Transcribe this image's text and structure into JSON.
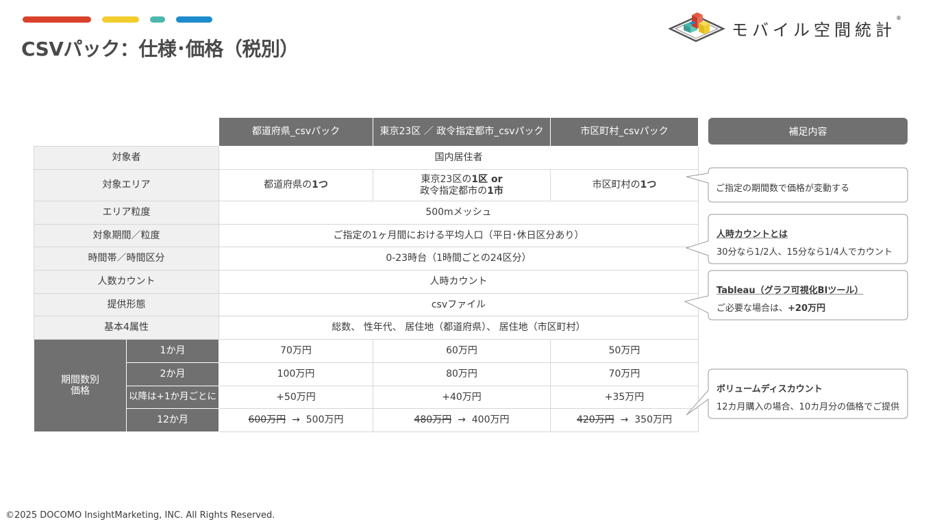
{
  "colors": {
    "bar_red": "#d9412b",
    "bar_yellow": "#f2cd2e",
    "bar_teal": "#4db7ad",
    "bar_blue": "#1d8ccc",
    "header_gray": "#707070",
    "rowhead_bg": "#f0f0f0"
  },
  "title": "CSVパック：仕様･価格（税別）",
  "logo": {
    "text": "モバイル空間統計",
    "mark": "®",
    "icon": "isometric-blocks-icon"
  },
  "table": {
    "columns": [
      "都道府県_csvパック",
      "東京23区 ／ 政令指定都市_csvパック",
      "市区町村_csvパック"
    ],
    "target_user": {
      "label": "対象者",
      "value": "国内居住者"
    },
    "area": {
      "label": "対象エリア",
      "pref": {
        "pre": "都道府県の",
        "bold": "1つ"
      },
      "tokyo": {
        "line1_pre": "東京23区の",
        "line1_bold": "1区 or",
        "line2_pre": "政令指定都市の",
        "line2_bold": "1市"
      },
      "city": {
        "pre": "市区町村の",
        "bold": "1つ"
      }
    },
    "granularity": {
      "label": "エリア粒度",
      "value": "500mメッシュ"
    },
    "period": {
      "label": "対象期間／粒度",
      "value": "ご指定の1ヶ月間における平均人口（平日･休日区分あり）"
    },
    "timeband": {
      "label": "時間帯／時間区分",
      "value": "0-23時台（1時間ごとの24区分）"
    },
    "count": {
      "label": "人数カウント",
      "value": "人時カウント"
    },
    "format": {
      "label": "提供形態",
      "value": "csvファイル"
    },
    "attrs": {
      "label": "基本4属性",
      "value": "総数、 性年代、 居住地（都道府県）、 居住地（市区町村）"
    },
    "price": {
      "group_line1": "期間数別",
      "group_line2": "価格",
      "rows": [
        {
          "label": "1か月",
          "pref": "70万円",
          "tokyo": "60万円",
          "city": "50万円"
        },
        {
          "label": "2か月",
          "pref": "100万円",
          "tokyo": "80万円",
          "city": "70万円"
        },
        {
          "label": "以降は+1か月ごとに",
          "pref": "+50万円",
          "tokyo": "+40万円",
          "city": "+35万円"
        }
      ],
      "twelve": {
        "label": "12か月",
        "arrow": "→",
        "pref_old": "600万円",
        "pref_new": "500万円",
        "tokyo_old": "480万円",
        "tokyo_new": "400万円",
        "city_old": "420万円",
        "city_new": "350万円"
      }
    }
  },
  "notes": {
    "header": "補足内容",
    "area_note": "ご指定の期間数で価格が変動する",
    "count_title": "人時カウントとは",
    "count_body": "30分なら1/2人、15分なら1/4人でカウント",
    "tableau_title": "Tableau（グラフ可視化BIツール）",
    "tableau_body_pre": "ご必要な場合は、",
    "tableau_body_bold": "+20万円",
    "volume_title": "ボリュームディスカウント",
    "volume_body": "12カ月購入の場合、10カ月分の価格でご提供"
  },
  "copyright": "©2025 DOCOMO InsightMarketing, INC. All Rights Reserved."
}
